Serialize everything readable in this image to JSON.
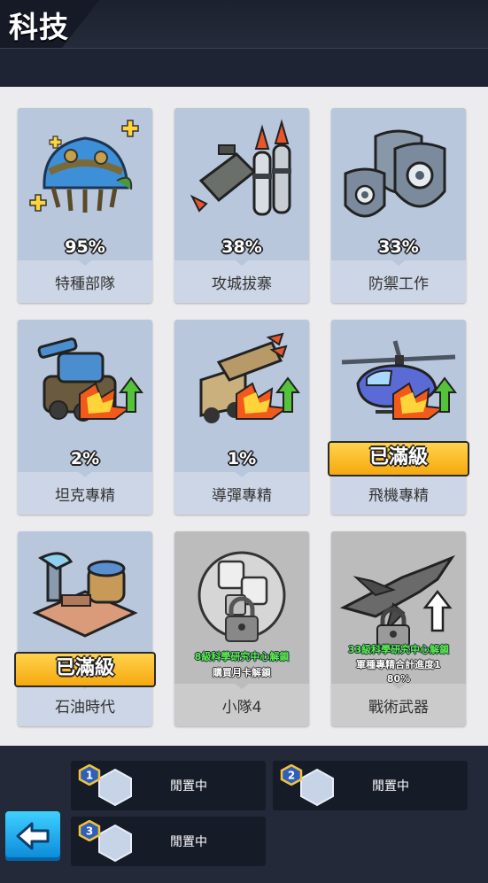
{
  "header": {
    "title": "科技"
  },
  "cards": [
    {
      "id": "special-forces",
      "percent": "95%",
      "name": "特種部隊"
    },
    {
      "id": "siege",
      "percent": "38%",
      "name": "攻城拔寨"
    },
    {
      "id": "defense",
      "percent": "33%",
      "name": "防禦工作"
    },
    {
      "id": "tank-mastery",
      "percent": "2%",
      "name": "坦克專精"
    },
    {
      "id": "missile-mastery",
      "percent": "1%",
      "name": "導彈專精"
    },
    {
      "id": "aircraft-mastery",
      "badge": "已滿級",
      "name": "飛機專精"
    },
    {
      "id": "oil-era",
      "badge": "已滿級",
      "name": "石油時代"
    },
    {
      "id": "squad-4",
      "name": "小隊4",
      "unlock_line1": "8級科學研究中心解鎖",
      "unlock_line2": "購買月卡解鎖"
    },
    {
      "id": "tactical-weapons",
      "name": "戰術武器",
      "unlock_line1": "33級科學研究中心解鎖",
      "unlock_line2": "軍種專精合計進度1",
      "unlock_line3": "80%"
    }
  ],
  "queue": [
    {
      "number": "1",
      "label": "閒置中"
    },
    {
      "number": "2",
      "label": "閒置中"
    },
    {
      "number": "3",
      "label": "閒置中"
    }
  ],
  "icons": {
    "back": "back-arrow-icon",
    "special-forces": "helmet-icon",
    "siege": "rocket-launcher-icon",
    "defense": "shield-gear-icon",
    "tank-mastery": "tank-upgrade-icon",
    "missile-mastery": "missile-truck-upgrade-icon",
    "aircraft-mastery": "helicopter-upgrade-icon",
    "oil-era": "oil-pump-icon",
    "squad-4": "locked-squad-icon",
    "tactical-weapons": "locked-jet-icon"
  },
  "colors": {
    "panel": "#ececee",
    "card": "#b9c7dd",
    "locked_card": "#bcbcbc",
    "max_badge": "#f6b320",
    "unlock_text": "#5df04b",
    "back_button": "#1ba6ec"
  }
}
